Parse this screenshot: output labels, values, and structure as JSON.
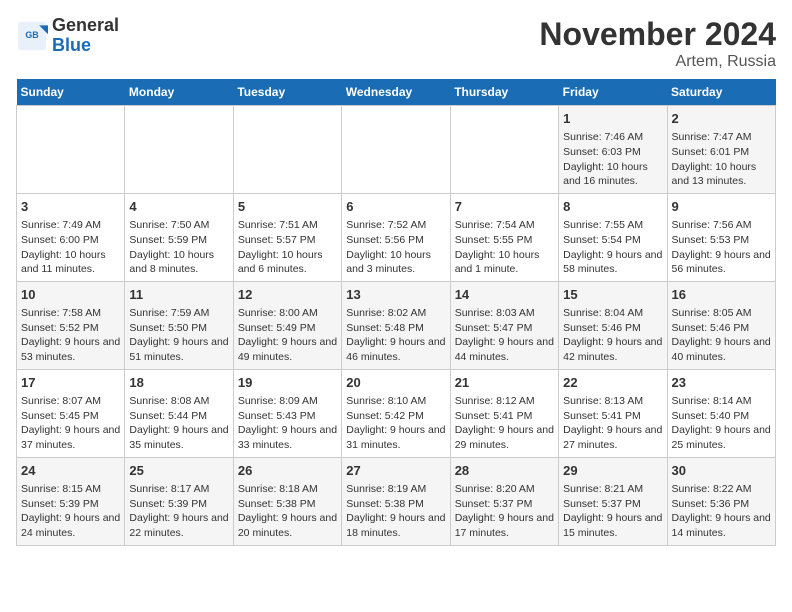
{
  "logo": {
    "line1": "General",
    "line2": "Blue"
  },
  "title": "November 2024",
  "location": "Artem, Russia",
  "days_of_week": [
    "Sunday",
    "Monday",
    "Tuesday",
    "Wednesday",
    "Thursday",
    "Friday",
    "Saturday"
  ],
  "weeks": [
    [
      {
        "day": "",
        "content": ""
      },
      {
        "day": "",
        "content": ""
      },
      {
        "day": "",
        "content": ""
      },
      {
        "day": "",
        "content": ""
      },
      {
        "day": "",
        "content": ""
      },
      {
        "day": "1",
        "content": "Sunrise: 7:46 AM\nSunset: 6:03 PM\nDaylight: 10 hours and 16 minutes."
      },
      {
        "day": "2",
        "content": "Sunrise: 7:47 AM\nSunset: 6:01 PM\nDaylight: 10 hours and 13 minutes."
      }
    ],
    [
      {
        "day": "3",
        "content": "Sunrise: 7:49 AM\nSunset: 6:00 PM\nDaylight: 10 hours and 11 minutes."
      },
      {
        "day": "4",
        "content": "Sunrise: 7:50 AM\nSunset: 5:59 PM\nDaylight: 10 hours and 8 minutes."
      },
      {
        "day": "5",
        "content": "Sunrise: 7:51 AM\nSunset: 5:57 PM\nDaylight: 10 hours and 6 minutes."
      },
      {
        "day": "6",
        "content": "Sunrise: 7:52 AM\nSunset: 5:56 PM\nDaylight: 10 hours and 3 minutes."
      },
      {
        "day": "7",
        "content": "Sunrise: 7:54 AM\nSunset: 5:55 PM\nDaylight: 10 hours and 1 minute."
      },
      {
        "day": "8",
        "content": "Sunrise: 7:55 AM\nSunset: 5:54 PM\nDaylight: 9 hours and 58 minutes."
      },
      {
        "day": "9",
        "content": "Sunrise: 7:56 AM\nSunset: 5:53 PM\nDaylight: 9 hours and 56 minutes."
      }
    ],
    [
      {
        "day": "10",
        "content": "Sunrise: 7:58 AM\nSunset: 5:52 PM\nDaylight: 9 hours and 53 minutes."
      },
      {
        "day": "11",
        "content": "Sunrise: 7:59 AM\nSunset: 5:50 PM\nDaylight: 9 hours and 51 minutes."
      },
      {
        "day": "12",
        "content": "Sunrise: 8:00 AM\nSunset: 5:49 PM\nDaylight: 9 hours and 49 minutes."
      },
      {
        "day": "13",
        "content": "Sunrise: 8:02 AM\nSunset: 5:48 PM\nDaylight: 9 hours and 46 minutes."
      },
      {
        "day": "14",
        "content": "Sunrise: 8:03 AM\nSunset: 5:47 PM\nDaylight: 9 hours and 44 minutes."
      },
      {
        "day": "15",
        "content": "Sunrise: 8:04 AM\nSunset: 5:46 PM\nDaylight: 9 hours and 42 minutes."
      },
      {
        "day": "16",
        "content": "Sunrise: 8:05 AM\nSunset: 5:46 PM\nDaylight: 9 hours and 40 minutes."
      }
    ],
    [
      {
        "day": "17",
        "content": "Sunrise: 8:07 AM\nSunset: 5:45 PM\nDaylight: 9 hours and 37 minutes."
      },
      {
        "day": "18",
        "content": "Sunrise: 8:08 AM\nSunset: 5:44 PM\nDaylight: 9 hours and 35 minutes."
      },
      {
        "day": "19",
        "content": "Sunrise: 8:09 AM\nSunset: 5:43 PM\nDaylight: 9 hours and 33 minutes."
      },
      {
        "day": "20",
        "content": "Sunrise: 8:10 AM\nSunset: 5:42 PM\nDaylight: 9 hours and 31 minutes."
      },
      {
        "day": "21",
        "content": "Sunrise: 8:12 AM\nSunset: 5:41 PM\nDaylight: 9 hours and 29 minutes."
      },
      {
        "day": "22",
        "content": "Sunrise: 8:13 AM\nSunset: 5:41 PM\nDaylight: 9 hours and 27 minutes."
      },
      {
        "day": "23",
        "content": "Sunrise: 8:14 AM\nSunset: 5:40 PM\nDaylight: 9 hours and 25 minutes."
      }
    ],
    [
      {
        "day": "24",
        "content": "Sunrise: 8:15 AM\nSunset: 5:39 PM\nDaylight: 9 hours and 24 minutes."
      },
      {
        "day": "25",
        "content": "Sunrise: 8:17 AM\nSunset: 5:39 PM\nDaylight: 9 hours and 22 minutes."
      },
      {
        "day": "26",
        "content": "Sunrise: 8:18 AM\nSunset: 5:38 PM\nDaylight: 9 hours and 20 minutes."
      },
      {
        "day": "27",
        "content": "Sunrise: 8:19 AM\nSunset: 5:38 PM\nDaylight: 9 hours and 18 minutes."
      },
      {
        "day": "28",
        "content": "Sunrise: 8:20 AM\nSunset: 5:37 PM\nDaylight: 9 hours and 17 minutes."
      },
      {
        "day": "29",
        "content": "Sunrise: 8:21 AM\nSunset: 5:37 PM\nDaylight: 9 hours and 15 minutes."
      },
      {
        "day": "30",
        "content": "Sunrise: 8:22 AM\nSunset: 5:36 PM\nDaylight: 9 hours and 14 minutes."
      }
    ]
  ]
}
